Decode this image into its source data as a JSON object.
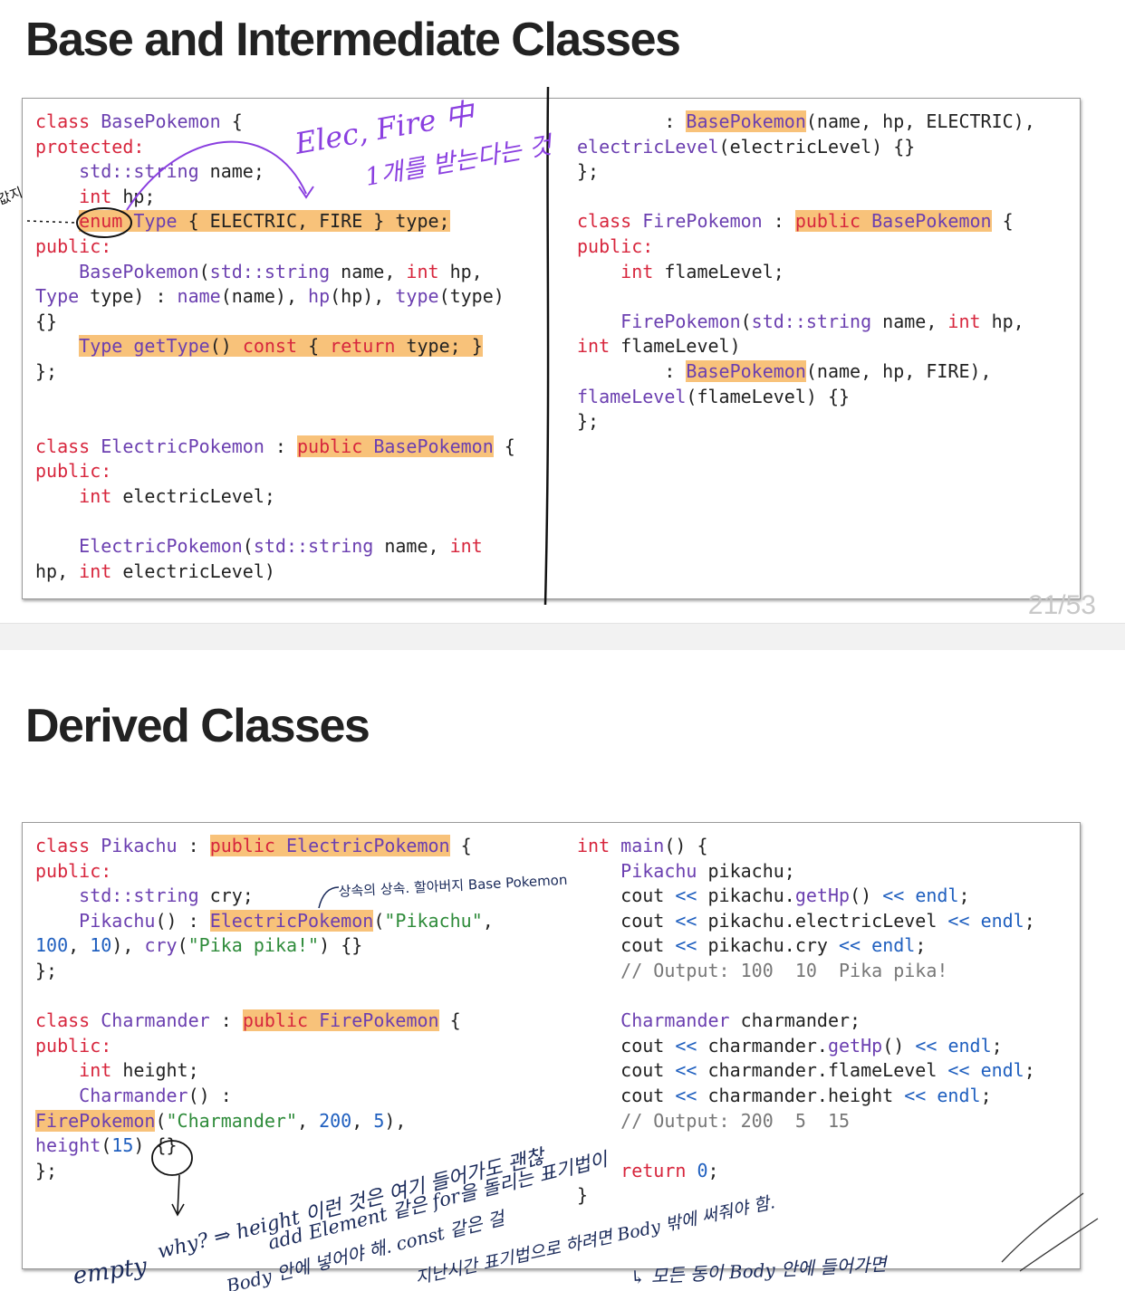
{
  "slide1": {
    "title": "Base and Intermediate Classes",
    "page": "21/53",
    "left": [
      [
        [
          "k",
          "class"
        ],
        [
          "p",
          " "
        ],
        [
          "t",
          "BasePokemon"
        ],
        [
          "p",
          " {"
        ]
      ],
      [
        [
          "k",
          "protected:"
        ]
      ],
      [
        [
          "p",
          "    "
        ],
        [
          "t",
          "std::string"
        ],
        [
          "p",
          " name;"
        ]
      ],
      [
        [
          "p",
          "    "
        ],
        [
          "k",
          "int"
        ],
        [
          "p",
          " hp;"
        ]
      ],
      [
        [
          "p",
          "    "
        ],
        [
          "hk",
          "enum"
        ],
        [
          "h",
          " "
        ],
        [
          "ht",
          "Type"
        ],
        [
          "h",
          " { ELECTRIC, FIRE } type;"
        ]
      ],
      [
        [
          "k",
          "public:"
        ]
      ],
      [
        [
          "p",
          "    "
        ],
        [
          "t",
          "BasePokemon"
        ],
        [
          "p",
          "("
        ],
        [
          "t",
          "std::string"
        ],
        [
          "p",
          " name, "
        ],
        [
          "k",
          "int"
        ],
        [
          "p",
          " hp,"
        ]
      ],
      [
        [
          "t",
          "Type"
        ],
        [
          "p",
          " type) : "
        ],
        [
          "t",
          "name"
        ],
        [
          "p",
          "(name), "
        ],
        [
          "t",
          "hp"
        ],
        [
          "p",
          "(hp), "
        ],
        [
          "t",
          "type"
        ],
        [
          "p",
          "(type)"
        ]
      ],
      [
        [
          "p",
          "{}"
        ]
      ],
      [
        [
          "p",
          "    "
        ],
        [
          "ht",
          "Type"
        ],
        [
          "h",
          " "
        ],
        [
          "ht",
          "getType"
        ],
        [
          "h",
          "() "
        ],
        [
          "hk",
          "const"
        ],
        [
          "h",
          " { "
        ],
        [
          "hk",
          "return"
        ],
        [
          "h",
          " type; }"
        ]
      ],
      [
        [
          "p",
          "};"
        ]
      ],
      [
        [
          "p",
          ""
        ]
      ],
      [
        [
          "p",
          ""
        ]
      ],
      [
        [
          "k",
          "class"
        ],
        [
          "p",
          " "
        ],
        [
          "t",
          "ElectricPokemon"
        ],
        [
          "p",
          " : "
        ],
        [
          "hk",
          "public"
        ],
        [
          "h",
          " "
        ],
        [
          "ht",
          "BasePokemon"
        ],
        [
          "p",
          " {"
        ]
      ],
      [
        [
          "k",
          "public:"
        ]
      ],
      [
        [
          "p",
          "    "
        ],
        [
          "k",
          "int"
        ],
        [
          "p",
          " electricLevel;"
        ]
      ],
      [
        [
          "p",
          ""
        ]
      ],
      [
        [
          "p",
          "    "
        ],
        [
          "t",
          "ElectricPokemon"
        ],
        [
          "p",
          "("
        ],
        [
          "t",
          "std::string"
        ],
        [
          "p",
          " name, "
        ],
        [
          "k",
          "int"
        ]
      ],
      [
        [
          "p",
          "hp, "
        ],
        [
          "k",
          "int"
        ],
        [
          "p",
          " electricLevel)"
        ]
      ]
    ],
    "right": [
      [
        [
          "p",
          "        : "
        ],
        [
          "ht",
          "BasePokemon"
        ],
        [
          "p",
          "(name, hp, ELECTRIC),"
        ]
      ],
      [
        [
          "t",
          "electricLevel"
        ],
        [
          "p",
          "(electricLevel) {}"
        ]
      ],
      [
        [
          "p",
          "};"
        ]
      ],
      [
        [
          "p",
          ""
        ]
      ],
      [
        [
          "k",
          "class"
        ],
        [
          "p",
          " "
        ],
        [
          "t",
          "FirePokemon"
        ],
        [
          "p",
          " : "
        ],
        [
          "hk",
          "public"
        ],
        [
          "h",
          " "
        ],
        [
          "ht",
          "BasePokemon"
        ],
        [
          "p",
          " {"
        ]
      ],
      [
        [
          "k",
          "public:"
        ]
      ],
      [
        [
          "p",
          "    "
        ],
        [
          "k",
          "int"
        ],
        [
          "p",
          " flameLevel;"
        ]
      ],
      [
        [
          "p",
          ""
        ]
      ],
      [
        [
          "p",
          "    "
        ],
        [
          "t",
          "FirePokemon"
        ],
        [
          "p",
          "("
        ],
        [
          "t",
          "std::string"
        ],
        [
          "p",
          " name, "
        ],
        [
          "k",
          "int"
        ],
        [
          "p",
          " hp,"
        ]
      ],
      [
        [
          "k",
          "int"
        ],
        [
          "p",
          " flameLevel)"
        ]
      ],
      [
        [
          "p",
          "        : "
        ],
        [
          "ht",
          "BasePokemon"
        ],
        [
          "p",
          "(name, hp, FIRE),"
        ]
      ],
      [
        [
          "t",
          "flameLevel"
        ],
        [
          "p",
          "(flameLevel) {}"
        ]
      ],
      [
        [
          "p",
          "};"
        ]
      ]
    ]
  },
  "slide2": {
    "title": "Derived Classes",
    "left": [
      [
        [
          "k",
          "class"
        ],
        [
          "p",
          " "
        ],
        [
          "t",
          "Pikachu"
        ],
        [
          "p",
          " : "
        ],
        [
          "hk",
          "public"
        ],
        [
          "h",
          " "
        ],
        [
          "ht",
          "ElectricPokemon"
        ],
        [
          "p",
          " {"
        ]
      ],
      [
        [
          "k",
          "public:"
        ]
      ],
      [
        [
          "p",
          "    "
        ],
        [
          "t",
          "std::string"
        ],
        [
          "p",
          " cry;"
        ]
      ],
      [
        [
          "p",
          "    "
        ],
        [
          "t",
          "Pikachu"
        ],
        [
          "p",
          "() : "
        ],
        [
          "ht",
          "ElectricPokemon"
        ],
        [
          "p",
          "("
        ],
        [
          "s",
          "\"Pikachu\""
        ],
        [
          "p",
          ","
        ]
      ],
      [
        [
          "n",
          "100"
        ],
        [
          "p",
          ", "
        ],
        [
          "n",
          "10"
        ],
        [
          "p",
          "), "
        ],
        [
          "t",
          "cry"
        ],
        [
          "p",
          "("
        ],
        [
          "s",
          "\"Pika pika!\""
        ],
        [
          "p",
          ") {}"
        ]
      ],
      [
        [
          "p",
          "};"
        ]
      ],
      [
        [
          "p",
          ""
        ]
      ],
      [
        [
          "k",
          "class"
        ],
        [
          "p",
          " "
        ],
        [
          "t",
          "Charmander"
        ],
        [
          "p",
          " : "
        ],
        [
          "hk",
          "public"
        ],
        [
          "h",
          " "
        ],
        [
          "ht",
          "FirePokemon"
        ],
        [
          "p",
          " {"
        ]
      ],
      [
        [
          "k",
          "public:"
        ]
      ],
      [
        [
          "p",
          "    "
        ],
        [
          "k",
          "int"
        ],
        [
          "p",
          " height;"
        ]
      ],
      [
        [
          "p",
          "    "
        ],
        [
          "t",
          "Charmander"
        ],
        [
          "p",
          "() :"
        ]
      ],
      [
        [
          "ht",
          "FirePokemon"
        ],
        [
          "p",
          "("
        ],
        [
          "s",
          "\"Charmander\""
        ],
        [
          "p",
          ", "
        ],
        [
          "n",
          "200"
        ],
        [
          "p",
          ", "
        ],
        [
          "n",
          "5"
        ],
        [
          "p",
          "),"
        ]
      ],
      [
        [
          "t",
          "height"
        ],
        [
          "p",
          "("
        ],
        [
          "n",
          "15"
        ],
        [
          "p",
          ") {}"
        ]
      ],
      [
        [
          "p",
          "};"
        ]
      ]
    ],
    "right": [
      [
        [
          "k",
          "int"
        ],
        [
          "p",
          " "
        ],
        [
          "t",
          "main"
        ],
        [
          "p",
          "() {"
        ]
      ],
      [
        [
          "p",
          "    "
        ],
        [
          "t",
          "Pikachu"
        ],
        [
          "p",
          " pikachu;"
        ]
      ],
      [
        [
          "p",
          "    cout "
        ],
        [
          "n",
          "<<"
        ],
        [
          "p",
          " pikachu."
        ],
        [
          "t",
          "getHp"
        ],
        [
          "p",
          "() "
        ],
        [
          "n",
          "<<"
        ],
        [
          "p",
          " "
        ],
        [
          "n",
          "endl"
        ],
        [
          "p",
          ";"
        ]
      ],
      [
        [
          "p",
          "    cout "
        ],
        [
          "n",
          "<<"
        ],
        [
          "p",
          " pikachu.electricLevel "
        ],
        [
          "n",
          "<<"
        ],
        [
          "p",
          " "
        ],
        [
          "n",
          "endl"
        ],
        [
          "p",
          ";"
        ]
      ],
      [
        [
          "p",
          "    cout "
        ],
        [
          "n",
          "<<"
        ],
        [
          "p",
          " pikachu.cry "
        ],
        [
          "n",
          "<<"
        ],
        [
          "p",
          " "
        ],
        [
          "n",
          "endl"
        ],
        [
          "p",
          ";"
        ]
      ],
      [
        [
          "c",
          "    // Output: 100  10  Pika pika!"
        ]
      ],
      [
        [
          "p",
          ""
        ]
      ],
      [
        [
          "p",
          "    "
        ],
        [
          "t",
          "Charmander"
        ],
        [
          "p",
          " charmander;"
        ]
      ],
      [
        [
          "p",
          "    cout "
        ],
        [
          "n",
          "<<"
        ],
        [
          "p",
          " charmander."
        ],
        [
          "t",
          "getHp"
        ],
        [
          "p",
          "() "
        ],
        [
          "n",
          "<<"
        ],
        [
          "p",
          " "
        ],
        [
          "n",
          "endl"
        ],
        [
          "p",
          ";"
        ]
      ],
      [
        [
          "p",
          "    cout "
        ],
        [
          "n",
          "<<"
        ],
        [
          "p",
          " charmander.flameLevel "
        ],
        [
          "n",
          "<<"
        ],
        [
          "p",
          " "
        ],
        [
          "n",
          "endl"
        ],
        [
          "p",
          ";"
        ]
      ],
      [
        [
          "p",
          "    cout "
        ],
        [
          "n",
          "<<"
        ],
        [
          "p",
          " charmander.height "
        ],
        [
          "n",
          "<<"
        ],
        [
          "p",
          " "
        ],
        [
          "n",
          "endl"
        ],
        [
          "p",
          ";"
        ]
      ],
      [
        [
          "c",
          "    // Output: 200  5  15"
        ]
      ],
      [
        [
          "p",
          ""
        ]
      ],
      [
        [
          "p",
          "    "
        ],
        [
          "k",
          "return"
        ],
        [
          "p",
          " "
        ],
        [
          "n",
          "0"
        ],
        [
          "p",
          ";"
        ]
      ],
      [
        [
          "p",
          "}"
        ]
      ]
    ]
  },
  "annotations": {
    "purple_note": "Elec, Fire 中 1개를 받는다는 것",
    "note_pointer": "값지",
    "inheritance_note": "상속의 상속. 할아버지 Base Pokemon",
    "empty_note": "empty why? ⇒ height 이런 것은 여기 들어가도 괜찮 add Element 같은 for을 돌리는 표기법이 Body 안에 넣어야 해. const 같은 걸 지난시간 표기법으로 하려면 Body 밖에 써줘야 함.",
    "body_note": "↳ 모든 동이 Body 안에 들어가면"
  },
  "colors": {
    "keyword": "#d7263d",
    "type": "#6b3fb0",
    "string": "#2e8b3a",
    "number": "#1f5fbf",
    "highlight": "#f8c27a",
    "ink_purple": "#8a3fe0",
    "ink_dark": "#1a2a5a"
  }
}
